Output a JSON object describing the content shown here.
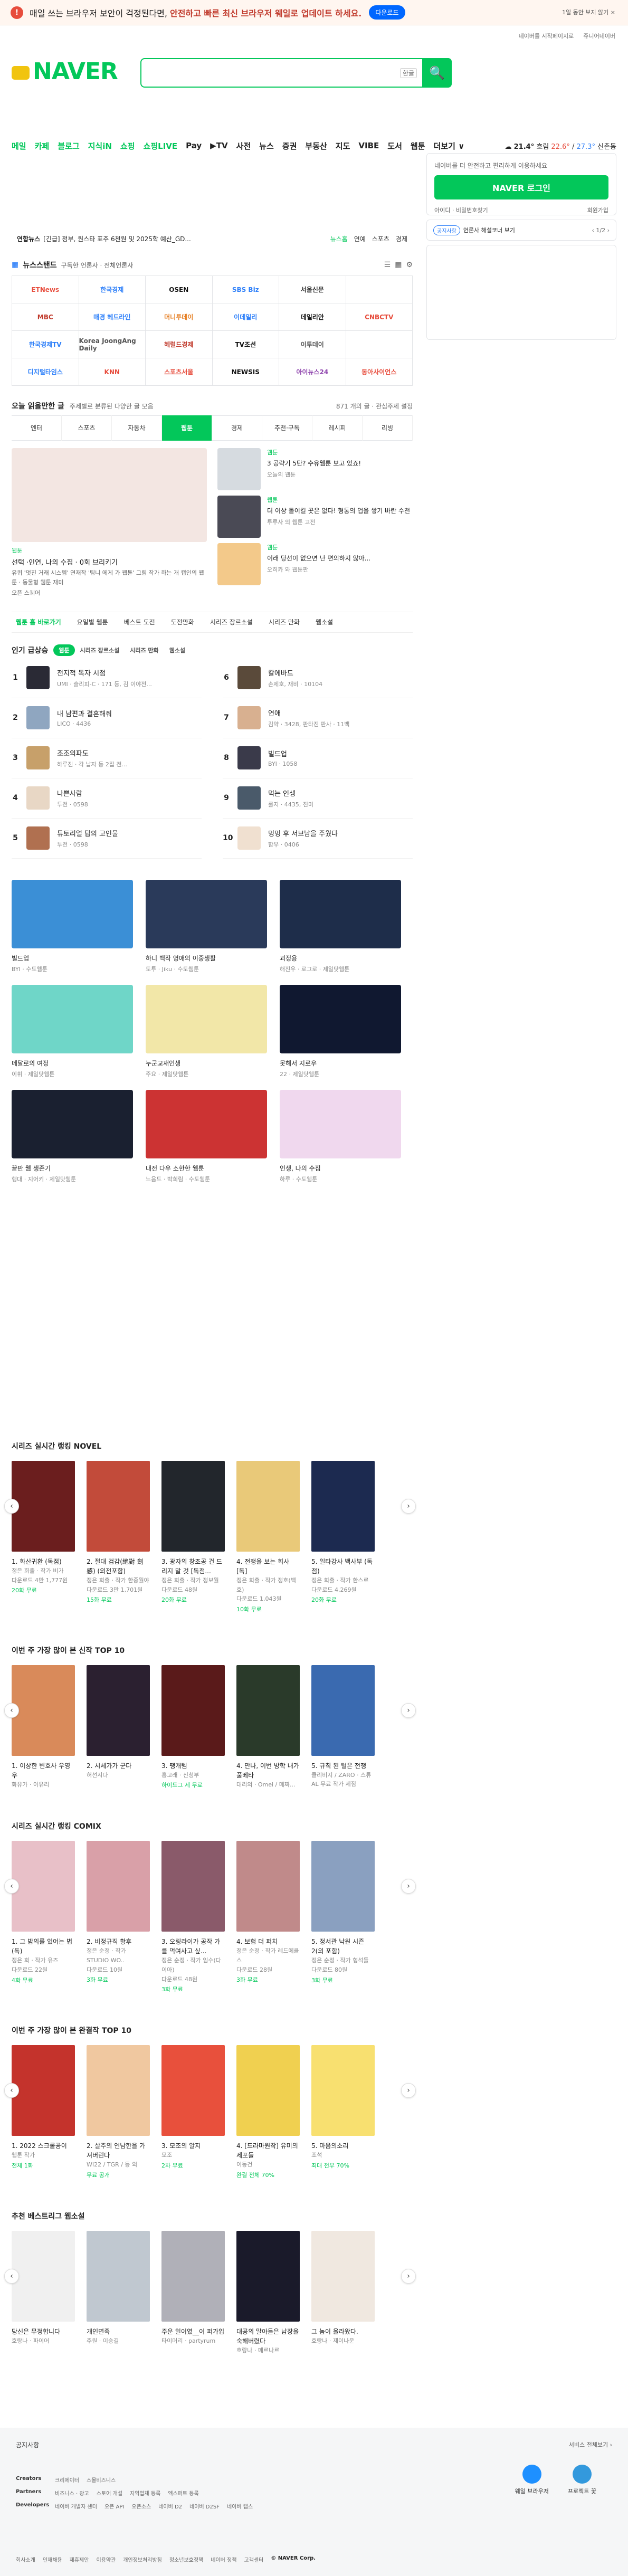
{
  "topbar": {
    "warn_icon": "!",
    "msg_pre": "매일 쓰는 브라우저 보안이 걱정된다면, ",
    "msg_bold": "안전하고 빠른 최신 브라우저 웨일로 업데이트 하세요.",
    "download": "다운로드",
    "close": "1일 동안 보지 않기 ×"
  },
  "util": {
    "a": "네이버를 시작페이지로",
    "b": "쥬니어네이버"
  },
  "logo": "NAVER",
  "search": {
    "placeholder": "",
    "kb": "한글",
    "btn_icon": "🔍"
  },
  "nav": {
    "items": [
      "메일",
      "카페",
      "블로그",
      "지식iN",
      "쇼핑",
      "쇼핑LIVE",
      "Pay",
      "▶TV",
      "사전",
      "뉴스",
      "증권",
      "부동산",
      "지도",
      "VIBE",
      "도서",
      "웹툰",
      "더보기 ∨"
    ],
    "weather": {
      "temp": "21.4°",
      "cond": "흐림",
      "low": "22.6°",
      "high": "27.3°",
      "place": "신촌동"
    }
  },
  "newsticker": {
    "tag": "연합뉴스",
    "text": "[긴급] 정부, 퀀스타 표주 6천원 및 2025학 예산_GD...",
    "links": [
      "뉴스홈",
      "연예",
      "스포츠",
      "경제"
    ]
  },
  "press": {
    "head": "뉴스스탠드",
    "sub": "구독한 언론사 · 전체언론사",
    "notice": "O23 빌드로 보기",
    "items": [
      "ETNews",
      "한국경제",
      "OSEN",
      "SBS Biz",
      "서울신문",
      "",
      "MBC",
      "매경 헤드라인",
      "머니투데이",
      "이데일리",
      "데일리안",
      "CNBCTV",
      "한국경제TV",
      "Korea JoongAng Daily",
      "헤럴드경제",
      "TV조선",
      "이투데이",
      "",
      "디지털타임스",
      "KNN",
      "스포츠서울",
      "NEWSIS",
      "아이뉴스24",
      "동아사이언스"
    ]
  },
  "login": {
    "text": "네이버를 더 안전하고 편리하게 이용하세요",
    "btn": "NAVER 로그인",
    "l1": "아이디 · 비밀번호찾기",
    "l2": "회원가입"
  },
  "notice": {
    "badge": "공지사항",
    "text": "언론사 해설코너 보기",
    "nav": "‹ 1/2 ›"
  },
  "today": {
    "title": "오늘 읽을만한 글",
    "sub": "주제별로 분류된 다양한 글 모음",
    "right": "871 개의 글 · 관심주제 설정"
  },
  "cattabs": [
    "엔터",
    "스포츠",
    "자동차",
    "웹툰",
    "경제",
    "추천·구독",
    "레시피",
    "리빙"
  ],
  "feat": {
    "big": {
      "cat": "웹툰",
      "title": "선택 ·인연, 나의 수집 · 0회 브리키기",
      "desc": "유퀴 '멋진 거래 시스템' 연재작 '팀니 에게 가 웹툰' 그림 작가 하는 개 캡인의 웹툰 · 동물형 웹툰 재미",
      "src": "오픈 스퀘어"
    },
    "items": [
      {
        "cat": "웹툰",
        "title": "3 공략기 5탄? 수유웹툰 보고 있죠!",
        "src": "오늘의 웹툰"
      },
      {
        "cat": "웹툰",
        "title": "더 이상 돌이킬 곳은 없다! 형통의 업을 쌓기 바란 수천",
        "src": "투루사 의 웹툰 고전"
      },
      {
        "cat": "웹툰",
        "title": "이래 당선이 없으면 난 편의하지 않아...",
        "src": "오히카 와 웹툰판"
      }
    ]
  },
  "subtabs": [
    "웹툰 홈 바로가기",
    "요일별 웹툰",
    "베스트 도전",
    "도전만화",
    "시리즈 장르소설",
    "시리즈 만화",
    "웹소설"
  ],
  "popular": {
    "title": "인기 급상승",
    "pills": [
      "웹툰",
      "시리즈 장르소설",
      "시리즈 만화",
      "웹소설"
    ],
    "items": [
      {
        "n": "1",
        "t": "전지적 독자 시점",
        "d": "UMI · 슬리피-C · 171 등, 김 이야전..."
      },
      {
        "n": "6",
        "t": "칼에바드",
        "d": "손제호, 재비 · 10104"
      },
      {
        "n": "2",
        "t": "내 남편과 결혼해줘",
        "d": "LICO · 4436"
      },
      {
        "n": "7",
        "t": "연애",
        "d": "김약 · 3428, 판타진 판사 · 11백"
      },
      {
        "n": "3",
        "t": "조조의파도",
        "d": "하루진 · 각 납자 등 2집 전..."
      },
      {
        "n": "8",
        "t": "빌드업",
        "d": "BYI · 1058"
      },
      {
        "n": "4",
        "t": "나쁜사람",
        "d": "투전 · 0598"
      },
      {
        "n": "9",
        "t": "먹는 인생",
        "d": "룰지 · 4435, 진미"
      },
      {
        "n": "5",
        "t": "튜토리얼 탑의 고인물",
        "d": "투전 · 0598"
      },
      {
        "n": "10",
        "t": "멍멍 후 서브남을 주웠다",
        "d": "함우 · 0406"
      }
    ]
  },
  "cards": [
    {
      "t": "빌드업",
      "d": "BYI · 수도웹툰"
    },
    {
      "t": "하니 백작 영애의 이중생활",
      "d": "도투 · Jiku · 수도웹툰"
    },
    {
      "t": "괴정용",
      "d": "해진우 · 로그로 · 제일닷웹툰"
    },
    {
      "t": "메달로의 여정",
      "d": "이휘 · 제일닷웹툰"
    },
    {
      "t": "누군교재인생",
      "d": "주요 · 제일닷웹툰"
    },
    {
      "t": "못해서 지로우",
      "d": "22 · 제일닷웹툰"
    },
    {
      "t": "끝판 웹 생존기",
      "d": "행대 · 지어키 · 제일닷웹툰"
    },
    {
      "t": "내전 다우 소한한 웹툰",
      "d": "느음드 · 박희림 · 수도웹툰"
    },
    {
      "t": "인생, 나의 수집",
      "d": "하루 · 수도웹툰"
    }
  ],
  "novel": {
    "title": "시리즈 실시간 랭킹 NOVEL",
    "items": [
      {
        "t": "1. 화산귀환 (독점)",
        "d": "정은 회출 · 작가 비가",
        "p": "다운로드 4만 1,777원",
        "g": "20화 무료"
      },
      {
        "t": "2. 절대 검감(絶對 劍感) (외전포함)",
        "d": "정은 회출 · 작가 한중월야",
        "p": "다운로드 3만 1,701원",
        "g": "15화 무료"
      },
      {
        "t": "3. 광자의 창조공 건 드리지 말 것 [독점...",
        "d": "정은 회출 · 작가 정보월",
        "p": "다운로드 48원",
        "g": "20화 무료"
      },
      {
        "t": "4. 전쟁을 보는 회사 [독]",
        "d": "정은 회출 · 작가 정호(백호)",
        "p": "다운로드 1,043원",
        "g": "10화 무료"
      },
      {
        "t": "5. 일타강사 백사부 (독점)",
        "d": "정은 회출 · 작가 한스로",
        "p": "다운로드 4,269원",
        "g": "20화 무료"
      }
    ]
  },
  "week": {
    "title": "이번 주 가장 많이 본 신작 TOP 10",
    "items": [
      {
        "t": "1. 이상한 변호사 우영우",
        "d": "화유가 · 이유리"
      },
      {
        "t": "2. 시체가가 군다",
        "d": "허선시다"
      },
      {
        "t": "3. 팽개템",
        "d": "홍고래 · 신청부",
        "g": "하이드그 세 무료"
      },
      {
        "t": "4. 만나, 이번 방학 내가 풀베타",
        "d": "대리의 · Omei / 메짜..."
      },
      {
        "t": "5. 규칙 된 털은 전쟁",
        "d": "클리비지 / ZARO · 스튜 AL 무료 작가 세짐"
      }
    ]
  },
  "comix": {
    "title": "시리즈 실시간 랭킹 COMIX",
    "items": [
      {
        "t": "1. 그 밤의를 있어는 법 (독)",
        "d": "정은 회 · 작가 유즈",
        "p": "다운로드 22원",
        "g": "4화 무료"
      },
      {
        "t": "2. 비정규직 황후",
        "d": "정은 순정 · 작가 STUDIO WO..",
        "p": "다운로드 10원",
        "g": "3화 무료"
      },
      {
        "t": "3. 오링라이가 공작 가를 먹여사고 싶...",
        "d": "정은 순정 · 작가 임수(다이아)",
        "p": "다운로드 48원",
        "g": "3화 무료"
      },
      {
        "t": "4. 보험 더 퍼치",
        "d": "정은 순정 · 작가 레드에클스",
        "p": "다운로드 28원",
        "g": "3화 무료"
      },
      {
        "t": "5. 정서관 낙원 시즌 2(외 포함)",
        "d": "정은 순정 · 작가 형석들",
        "p": "다운로드 80원",
        "g": "3화 무료"
      }
    ]
  },
  "manga": {
    "title": "이번 주 가장 많이 본 완결작 TOP 10",
    "items": [
      {
        "t": "1. 2022 스크롤공이",
        "d": "웹툰 작가",
        "g": "전체 1화"
      },
      {
        "t": "2. 살주의 연남한을 가져버린다",
        "d": "WI22 / TGR / 등 외",
        "g": "무료 공개"
      },
      {
        "t": "3. 모조의 알지",
        "d": "모조",
        "g": "2차 무료"
      },
      {
        "t": "4. [드라마원작] 유미의 세포들",
        "d": "이동건",
        "g": "완결 전체 70%"
      },
      {
        "t": "5. 마음의소리",
        "d": "조석",
        "g": "최대 전부 70%"
      }
    ]
  },
  "recommend": {
    "title": "추천 베스트리그 웹소설",
    "items": [
      {
        "t": "당신은 무정합니다",
        "d": "호랑나 · 파이어"
      },
      {
        "t": "개인면족",
        "d": "주원 · 이승길"
      },
      {
        "t": "주운 일이였__이 퍼가입",
        "d": "타이머리 · partyrum"
      },
      {
        "t": "대공의 말아들은 남장을 숙해버렸다",
        "d": "호랑나 · 메르나르"
      },
      {
        "t": "그 놈이 올라왔다.",
        "d": "호랑나 · 제이나운"
      }
    ]
  },
  "footer": {
    "title": "공지사항",
    "right": "서비스 전체보기 ›",
    "rows": [
      {
        "k": "Creators",
        "v": [
          "크리에이터",
          "스몰비즈니스"
        ]
      },
      {
        "k": "Partners",
        "v": [
          "비즈니스 · 광고",
          "스토어 개설",
          "지역업체 등록",
          "엑스퍼트 등록"
        ]
      },
      {
        "k": "Developers",
        "v": [
          "네이버 개발자 센터",
          "오픈 API",
          "오픈소스",
          "네이버 D2",
          "네이버 D2SF",
          "네이버 랩스"
        ]
      }
    ],
    "side": [
      "웨일 브라우저",
      "프로젝트 꽃"
    ],
    "bottom": [
      "회사소개",
      "인재채용",
      "제휴제안",
      "이용약관",
      "개인정보처리방침",
      "청소년보호정책",
      "네이버 정책",
      "고객센터",
      "© NAVER Corp."
    ]
  }
}
